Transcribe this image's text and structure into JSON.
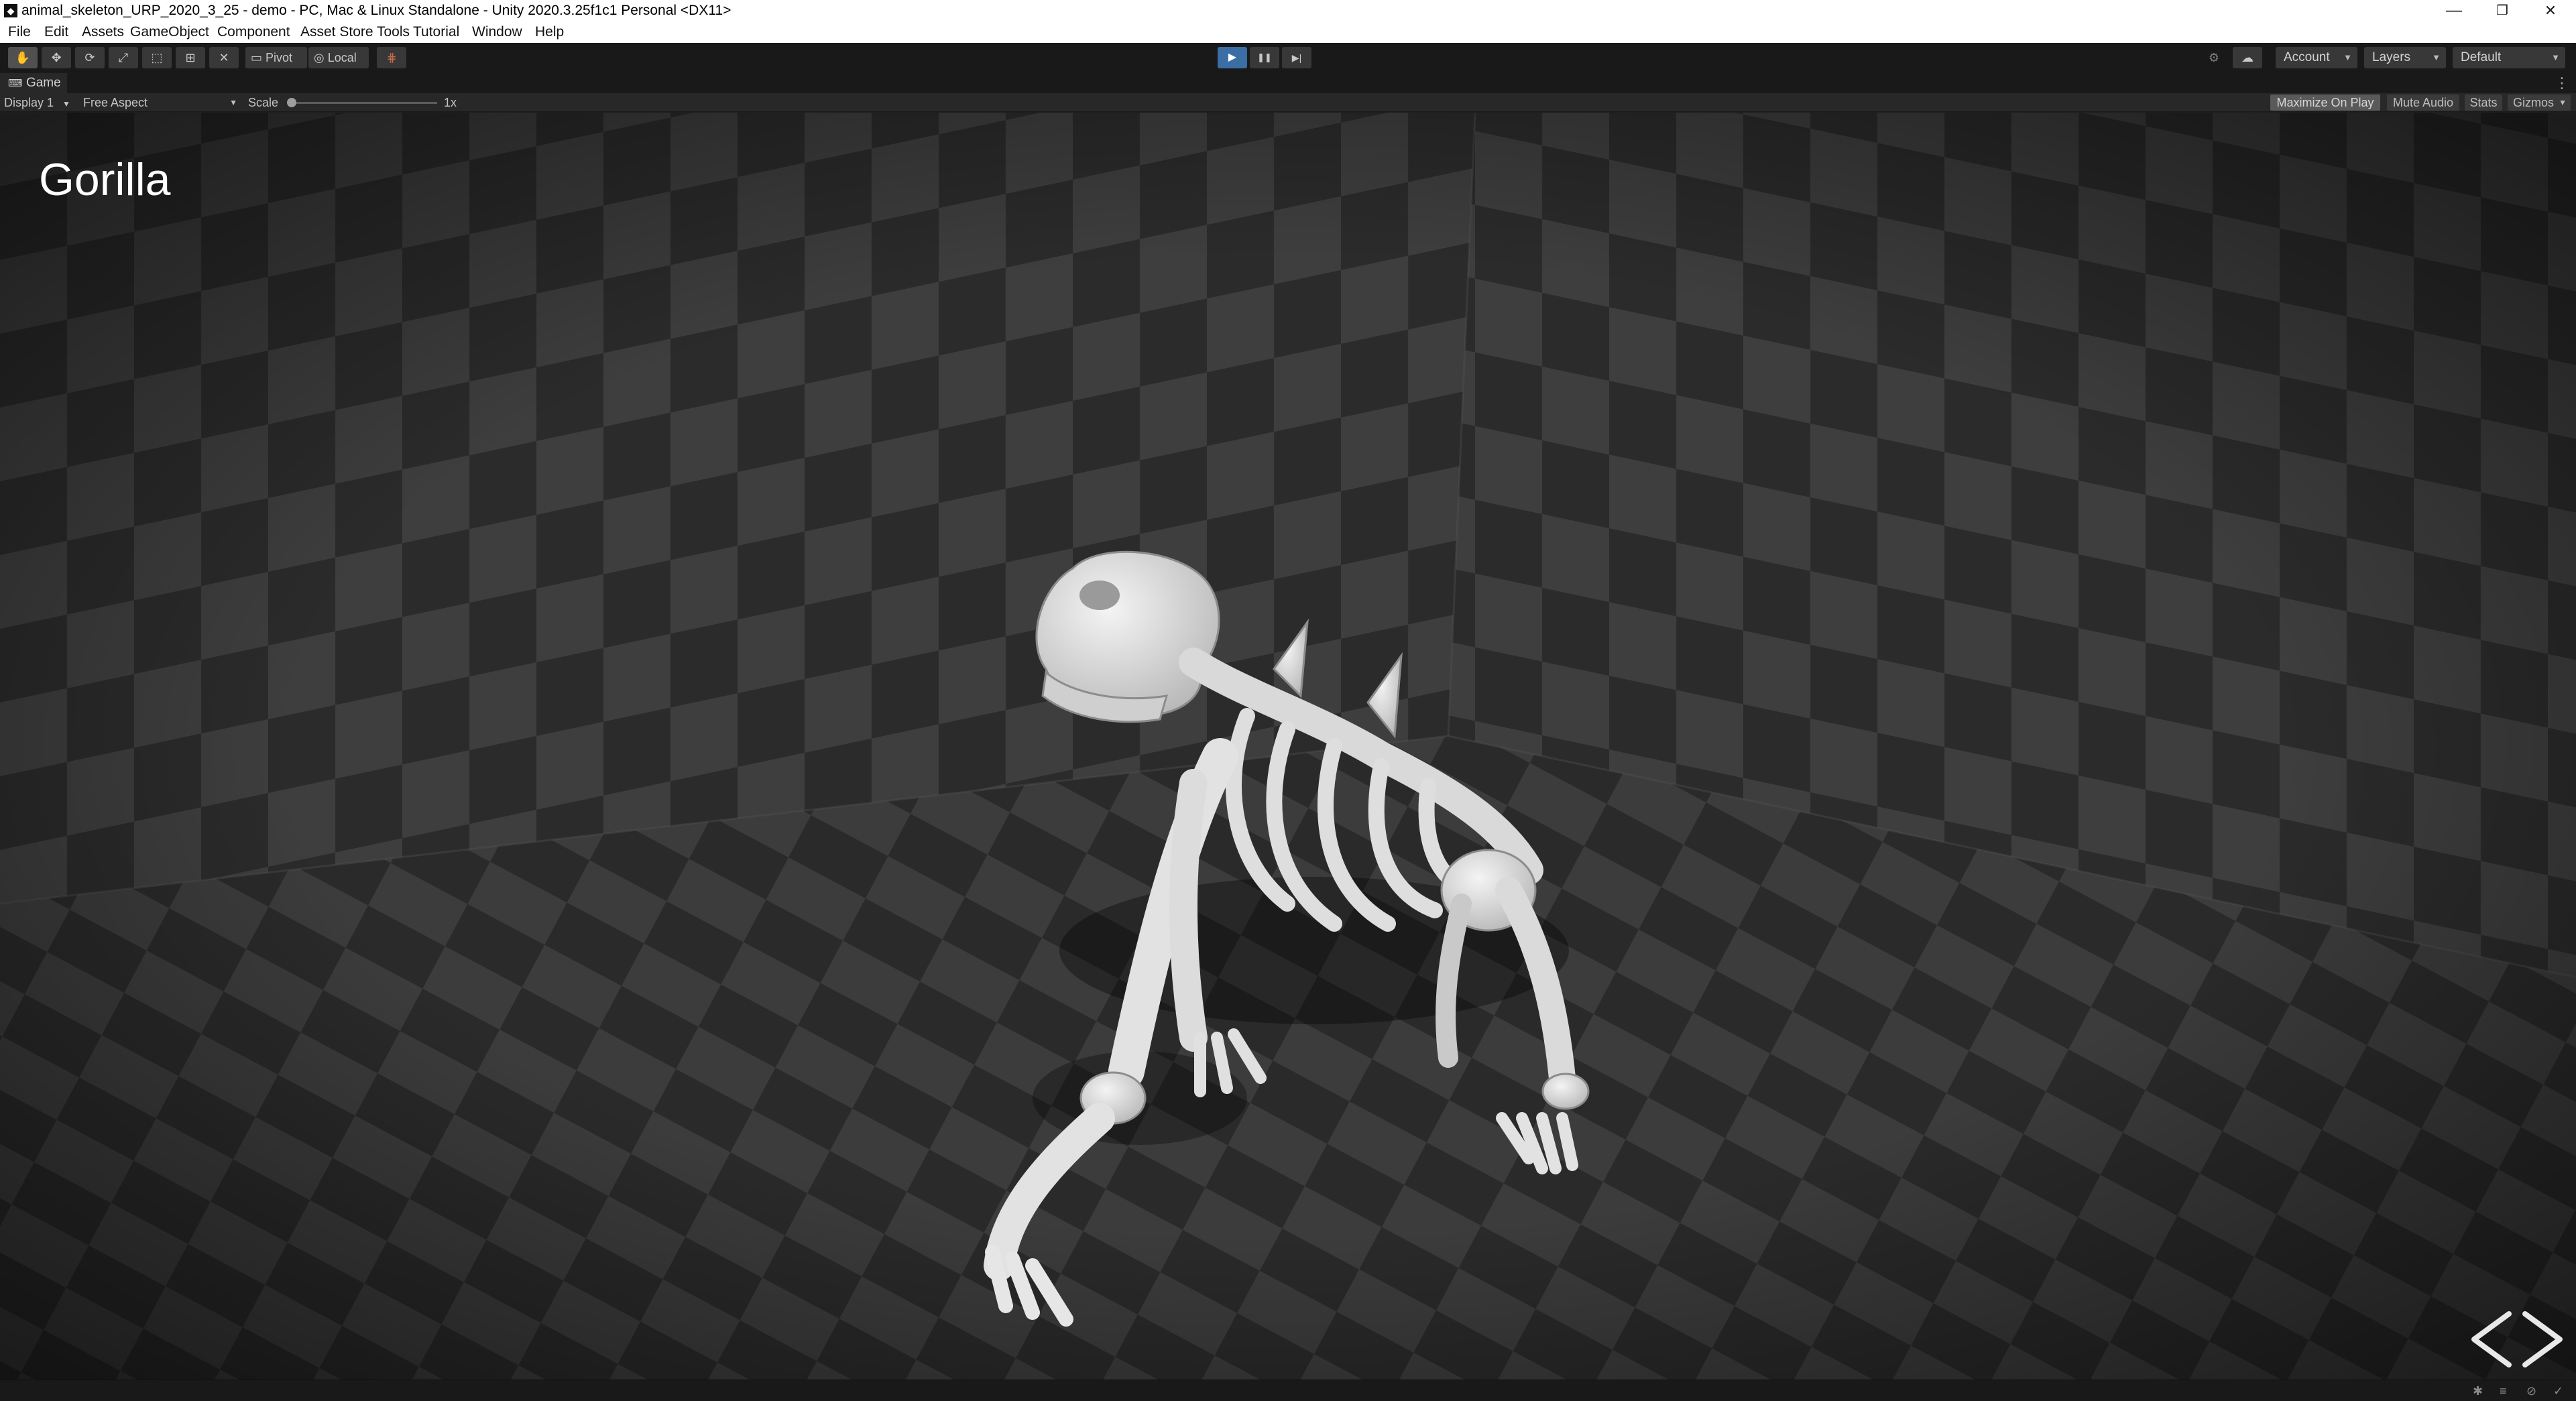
{
  "window": {
    "title": "animal_skeleton_URP_2020_3_25 - demo - PC, Mac & Linux Standalone - Unity 2020.3.25f1c1 Personal <DX11>",
    "app_icon": "unity-icon",
    "controls": {
      "minimize": "—",
      "restore": "❐",
      "close": "✕"
    }
  },
  "menu": [
    "File",
    "Edit",
    "Assets",
    "GameObject",
    "Component",
    "Asset Store Tools",
    "Tutorial",
    "Window",
    "Help"
  ],
  "toolbar": {
    "tools": [
      {
        "name": "hand-tool-icon",
        "glyph": "✋"
      },
      {
        "name": "move-tool-icon",
        "glyph": "✥"
      },
      {
        "name": "rotate-tool-icon",
        "glyph": "⟳"
      },
      {
        "name": "scale-tool-icon",
        "glyph": "⤢"
      },
      {
        "name": "rect-tool-icon",
        "glyph": "⬚"
      },
      {
        "name": "transform-tool-icon",
        "glyph": "⊞"
      },
      {
        "name": "custom-tool-icon",
        "glyph": "✕"
      }
    ],
    "pivot_label": "Pivot",
    "local_label": "Local",
    "grid_snap_glyph": "⋕",
    "play_glyph": "▶",
    "pause_glyph": "❚❚",
    "step_glyph": "▶|",
    "collab_glyph": "⚙",
    "cloud_glyph": "☁",
    "account_label": "Account",
    "layers_label": "Layers",
    "layout_label": "Default"
  },
  "game_tab": {
    "label": "Game",
    "icon": "game-controller-icon",
    "menu_glyph": "⋮"
  },
  "game_toolbar": {
    "display": "Display 1",
    "aspect": "Free Aspect",
    "scale_label": "Scale",
    "scale_value": "1x",
    "scale_fraction": 0.0,
    "maximize_on_play": "Maximize On Play",
    "mute_audio": "Mute Audio",
    "stats": "Stats",
    "gizmos": "Gizmos"
  },
  "scene": {
    "animal_name": "Gorilla",
    "prev_icon": "chevron-left-icon",
    "next_icon": "chevron-right-icon"
  },
  "colors": {
    "editor_dark": "#191919",
    "panel": "#282828",
    "play_active": "#3a6ea5",
    "checker_dark": "#2a2a2a",
    "checker_light": "#3d3d3d",
    "bone": "#e6e6e6"
  },
  "status_icons": [
    "bug-icon",
    "layers-icon",
    "no-entry-icon",
    "check-icon"
  ]
}
